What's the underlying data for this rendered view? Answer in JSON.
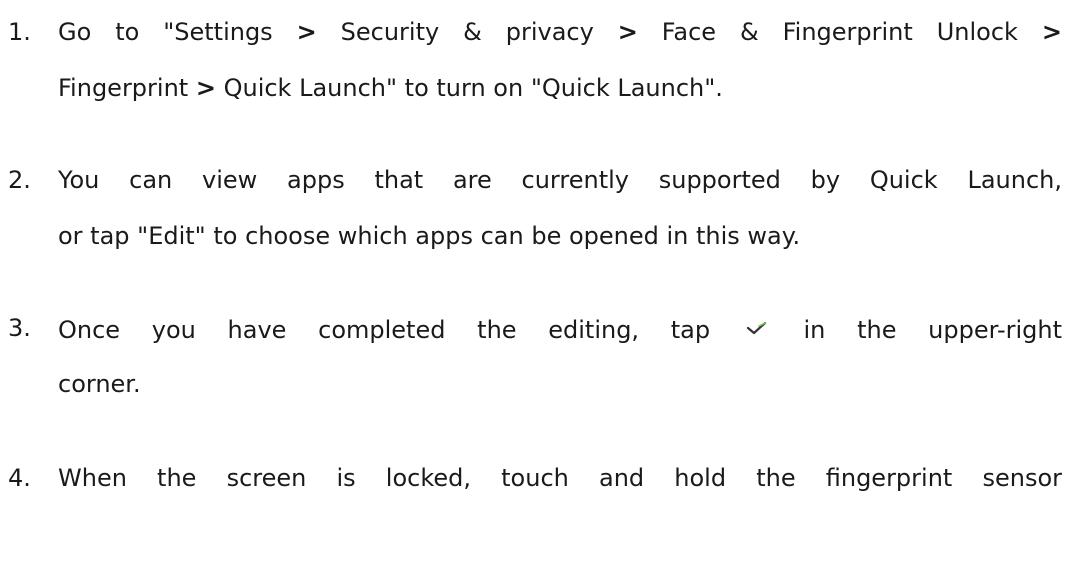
{
  "steps": [
    {
      "number": "1.",
      "line1_parts": [
        "Go to \"Settings",
        ">",
        "Security & privacy",
        ">",
        "Face & Fingerprint Unlock",
        ">"
      ],
      "line2_parts": [
        "Fingerprint",
        ">",
        "Quick Launch\" to turn on \"Quick Launch\"."
      ]
    },
    {
      "number": "2.",
      "line1": "You can view apps that are currently supported by Quick Launch,",
      "line2": "or tap \"Edit\" to choose which apps can be opened in this way."
    },
    {
      "number": "3.",
      "line1_before": "Once you have completed the editing, tap",
      "line1_after": "in the upper-right",
      "line2": "corner.",
      "icon": "checkmark-icon"
    },
    {
      "number": "4.",
      "line1": "When the screen is locked, touch and hold the fingerprint sensor"
    }
  ],
  "colors": {
    "text": "#1a1a1a",
    "check_dark": "#333333",
    "check_accent": "#7ccf5a"
  }
}
